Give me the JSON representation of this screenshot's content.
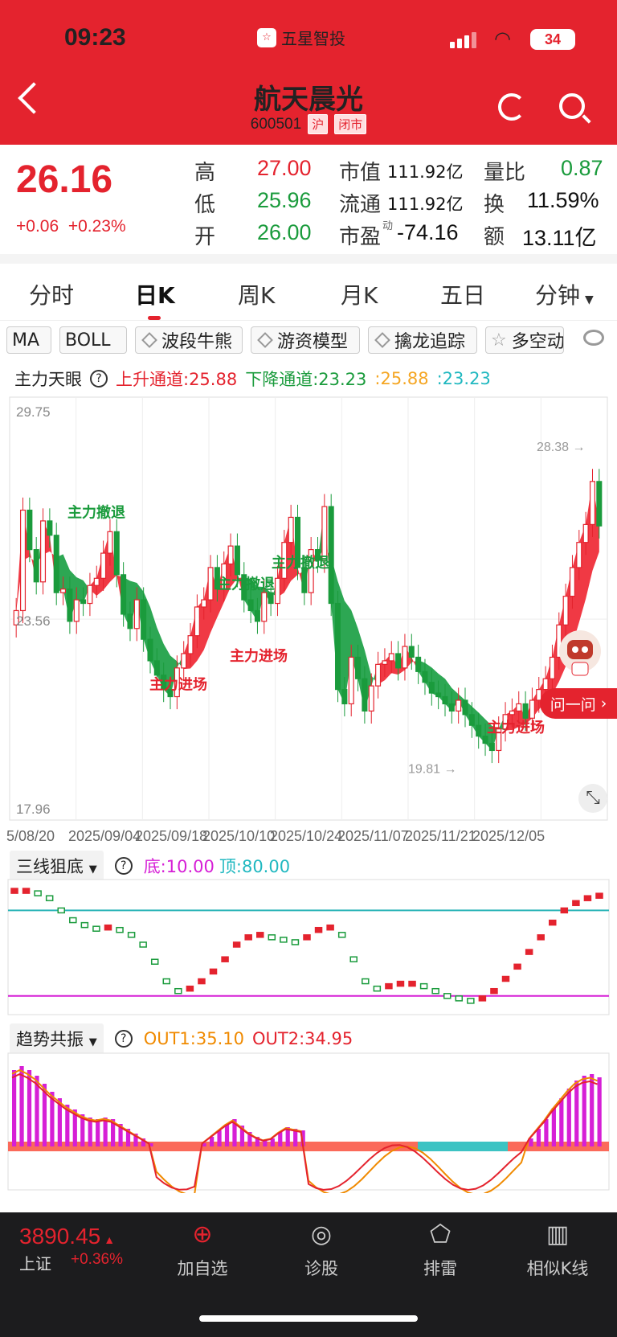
{
  "status": {
    "time": "09:23",
    "brand": "五星智投",
    "battery": "34"
  },
  "stock": {
    "name": "航天晨光",
    "code": "600501",
    "market_tag": "沪",
    "state_tag": "闭市"
  },
  "quote": {
    "price": "26.16",
    "change": "+0.06",
    "change_pct": "+0.23%",
    "high_label": "高",
    "high": "27.00",
    "low_label": "低",
    "low": "25.96",
    "open_label": "开",
    "open": "26.00",
    "mcap_label": "市值",
    "mcap": "111.92亿",
    "float_label": "流通",
    "float": "111.92亿",
    "pe_label": "市盈",
    "pe_sup": "动",
    "pe": "-74.16",
    "vr_label": "量比",
    "vr": "0.87",
    "turnover_label": "换",
    "turnover": "11.59%",
    "amount_label": "额",
    "amount": "13.11亿"
  },
  "tabs": [
    "分时",
    "日K",
    "周K",
    "月K",
    "五日",
    "分钟"
  ],
  "chips": [
    "MA",
    "BOLL",
    "波段牛熊",
    "游资模型",
    "擒龙追踪",
    "多空动"
  ],
  "main_indicator": {
    "name": "主力天眼",
    "up_label": "上升通道:25.88",
    "down_label": "下降通道:23.23",
    "v1": ":25.88",
    "v2": ":23.23"
  },
  "chart_data": [
    {
      "type": "candlestick",
      "title": "主力天眼",
      "ylim": [
        17.96,
        29.75
      ],
      "y_ticks": [
        "29.75",
        "23.56",
        "17.96"
      ],
      "x_ticks": [
        "5/08/20",
        "2025/09/04",
        "2025/09/18",
        "2025/10/10",
        "2025/10/24",
        "2025/11/07",
        "2025/11/21",
        "2025/12/05"
      ],
      "annotations": [
        "主力撤退",
        "主力撤退",
        "主力撤退",
        "主力进场",
        "主力进场",
        "主力进场"
      ],
      "max_label": "28.38 →",
      "min_label": "19.81 →",
      "close": [
        23.8,
        26.6,
        25.5,
        24.6,
        26.3,
        25.9,
        24.3,
        24.4,
        23.5,
        24.1,
        24.0,
        24.5,
        24.7,
        25.4,
        26.0,
        24.8,
        23.7,
        23.3,
        24.1,
        23.0,
        22.4,
        22.0,
        21.6,
        21.4,
        22.2,
        22.6,
        23.1,
        23.9,
        24.1,
        25.0,
        24.4,
        25.1,
        25.6,
        24.8,
        24.1,
        23.8,
        23.5,
        24.3,
        24.0,
        24.7,
        25.7,
        26.4,
        25.0,
        24.3,
        25.5,
        25.2,
        26.7,
        24.0,
        21.6,
        21.2,
        22.5,
        21.9,
        21.0,
        21.7,
        22.3,
        22.4,
        22.6,
        22.2,
        22.8,
        22.5,
        22.1,
        21.8,
        21.5,
        21.4,
        21.2,
        21.0,
        21.3,
        20.9,
        20.6,
        20.3,
        20.1,
        19.9,
        20.5,
        20.9,
        21.0,
        21.2,
        20.8,
        21.3,
        21.6,
        21.9,
        22.5,
        23.4,
        24.2,
        25.0,
        25.7,
        26.2,
        27.4,
        26.16
      ]
    },
    {
      "type": "line",
      "title": "三线狙底",
      "bottom_label": "底:10.00",
      "top_label": "顶:80.00",
      "ylim": [
        0,
        100
      ]
    },
    {
      "type": "bar",
      "title": "趋势共振",
      "out1_label": "OUT1:35.10",
      "out2_label": "OUT2:34.95"
    }
  ],
  "sub1": {
    "name": "三线狙底",
    "bottom": "底:10.00",
    "top": "顶:80.00"
  },
  "sub2": {
    "name": "趋势共振",
    "out1": "OUT1:35.10",
    "out2": "OUT2:34.95"
  },
  "ask_label": "问一问",
  "bottom": {
    "index_value": "3890.45",
    "index_name": "上证",
    "index_change": "+0.36%",
    "nav": [
      "加自选",
      "诊股",
      "排雷",
      "相似K线"
    ]
  }
}
